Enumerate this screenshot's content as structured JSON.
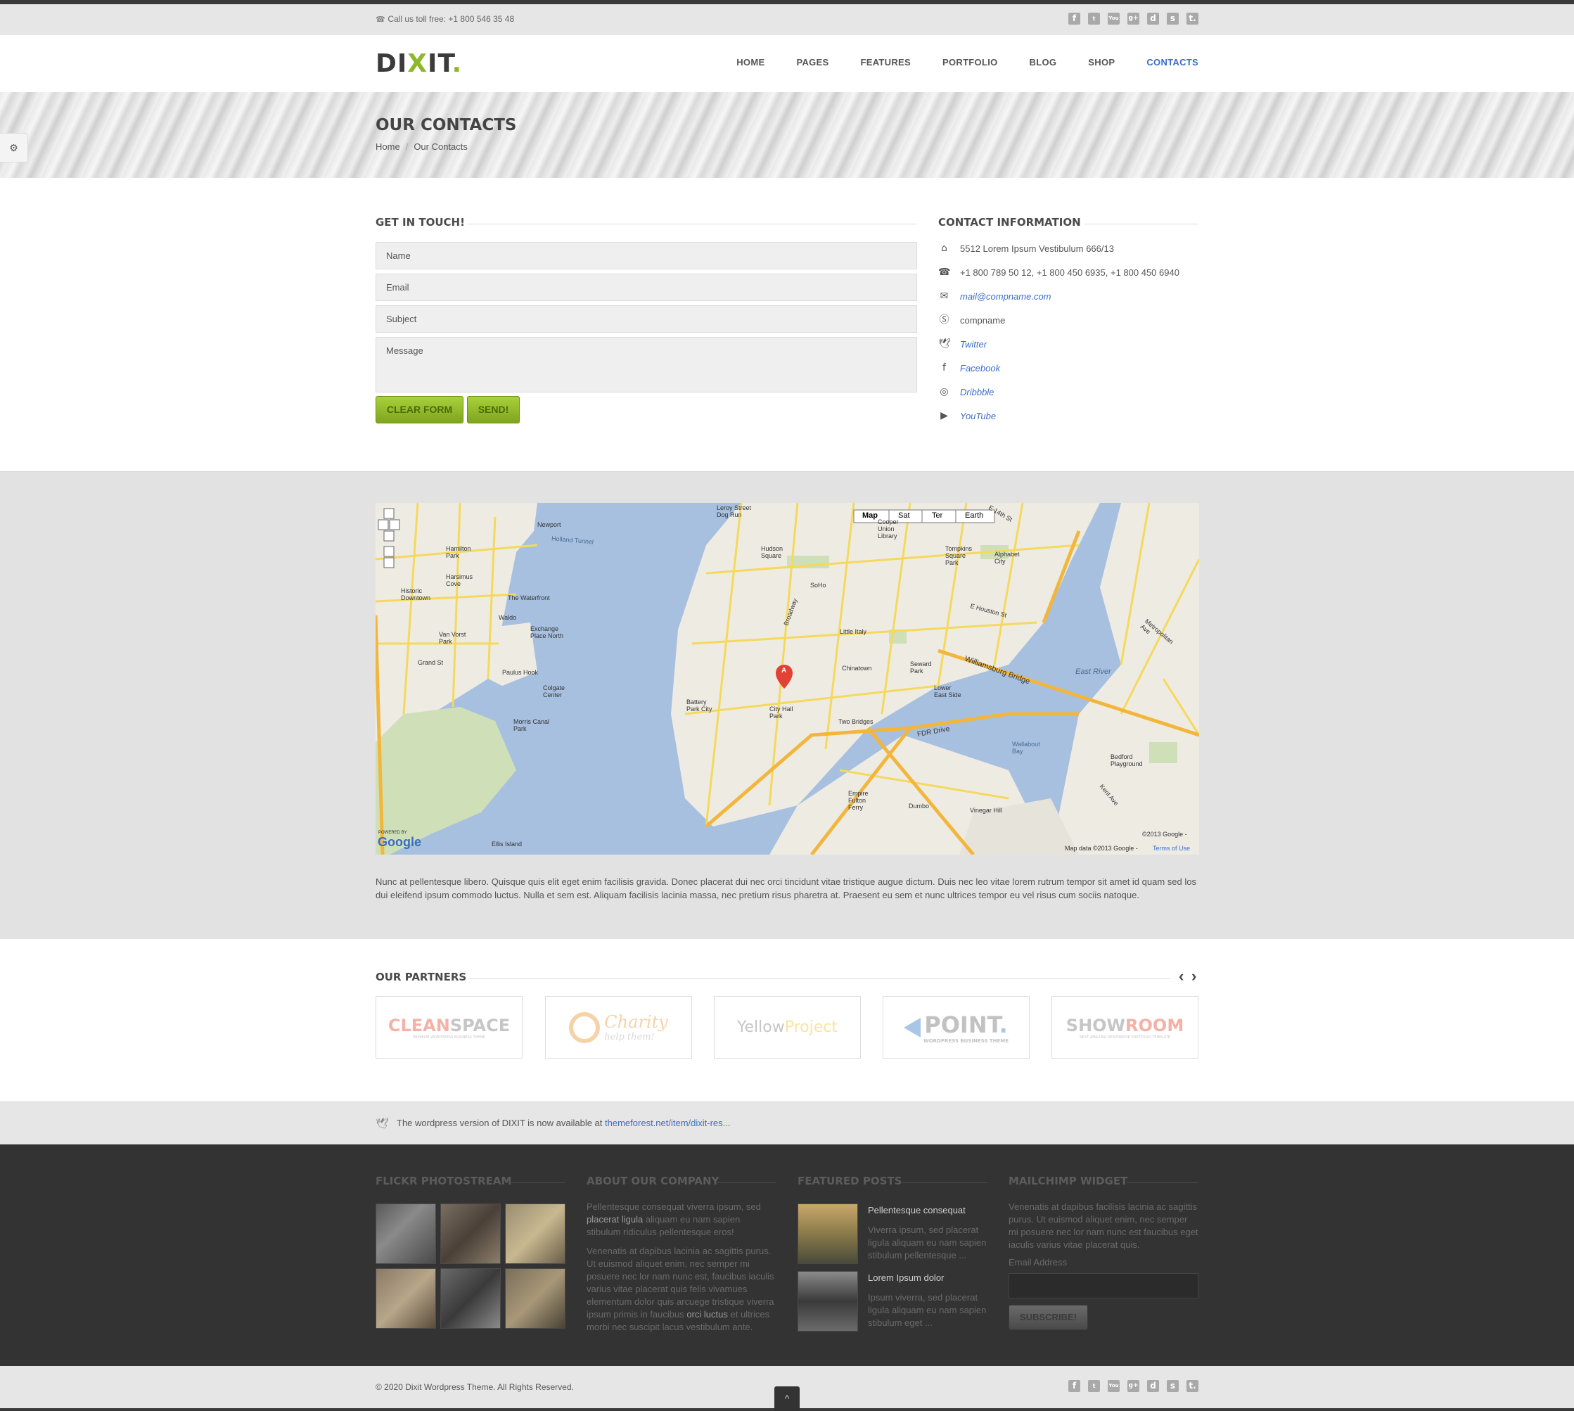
{
  "topbar": {
    "phone_label": "Call us toll free:",
    "phone_number": "+1 800 546 35 48"
  },
  "socials": [
    "f",
    "t",
    "You",
    "g+",
    "d",
    "s",
    "t."
  ],
  "header": {
    "logo_text": "DI",
    "logo_x": "X",
    "logo_rest": "IT",
    "logo_dot": ".",
    "nav": [
      "HOME",
      "PAGES",
      "FEATURES",
      "PORTFOLIO",
      "BLOG",
      "SHOP",
      "CONTACTS"
    ]
  },
  "page": {
    "title": "OUR CONTACTS",
    "breadcrumb_home": "Home",
    "breadcrumb_sep": "/",
    "breadcrumb_current": "Our Contacts"
  },
  "form": {
    "title": "GET IN TOUCH!",
    "name_placeholder": "Name",
    "email_placeholder": "Email",
    "subject_placeholder": "Subject",
    "message_placeholder": "Message",
    "clear_label": "CLEAR FORM",
    "send_label": "SEND!"
  },
  "contact_info": {
    "title": "CONTACT INFORMATION",
    "address": "5512 Lorem Ipsum Vestibulum 666/13",
    "phones": "+1 800 789 50 12, +1 800 450 6935, +1 800 450 6940",
    "email": "mail@compname.com",
    "skype": "compname",
    "twitter": "Twitter",
    "facebook": "Facebook",
    "dribbble": "Dribbble",
    "youtube": "YouTube"
  },
  "map": {
    "tabs": [
      "Map",
      "Sat",
      "Ter",
      "Earth"
    ],
    "labels": [
      "Newport",
      "Hamilton Park",
      "Harsimus Cove",
      "Historic Downtown",
      "The Waterfront",
      "Van Vorst Park",
      "Waldo",
      "Exchange Place North",
      "Paulus Hook",
      "Colgate Center",
      "Morris Canal Park",
      "Ellis Island",
      "Leroy Street Dog Run",
      "Hudson Square",
      "SoHo",
      "Little Italy",
      "Chinatown",
      "Battery Park City",
      "City Hall Park",
      "Two Bridges",
      "Lower East Side",
      "Seward Park",
      "Tompkins Square Park",
      "Alphabet City",
      "Cooper Union Library",
      "East River",
      "Wallabout Bay",
      "Bedford Playground",
      "Dumbo",
      "Vinegar Hill",
      "Empire Fulton Ferry",
      "Williamsburg Bridge",
      "FDR Drive",
      "Holland Tunnel",
      "Grand St",
      "Broadway",
      "E Houston St",
      "E 14th St",
      "Metropolitan Ave",
      "Kent Ave"
    ],
    "powered_by": "POWERED BY",
    "google": "Google",
    "copyright": "©2013 Google -",
    "map_data": "Map data ©2013 Google -",
    "terms": "Terms of Use",
    "marker": "A"
  },
  "map_description": "Nunc at pellentesque libero. Quisque quis elit eget enim facilisis gravida. Donec placerat dui nec orci tincidunt vitae tristique augue dictum. Duis nec leo vitae lorem rutrum tempor sit amet id quam sed los dui eleifend ipsum commodo luctus. Nulla et sem est. Aliquam facilisis lacinia massa, nec pretium risus pharetra at. Praesent eu sem et nunc ultrices tempor eu vel risus cum sociis natoque.",
  "partners": {
    "title": "OUR PARTNERS",
    "prev": "‹",
    "next": "›",
    "items": [
      {
        "a": "CLEAN",
        "b": "SPACE",
        "sub": "PREMIUM WORDPRESS BUSINESS THEME"
      },
      {
        "a": "Charity",
        "b": "help them!",
        "sub": ""
      },
      {
        "a": "Yellow",
        "b": "Project",
        "sub": ""
      },
      {
        "a": "POINT",
        "b": ".",
        "sub": "WORDPRESS BUSINESS THEME"
      },
      {
        "a": "SHOW",
        "b": "ROOM",
        "sub": "NEXT AMAZING RESPONSIVE PORTFOLIO TEMPLATE"
      }
    ]
  },
  "tweet": {
    "text": "The wordpress version of DIXIT is now available at",
    "link": "themeforest.net/item/dixit-res..."
  },
  "footer": {
    "flickr_title": "FLICKR PHOTOSTREAM",
    "about_title": "ABOUT OUR COMPANY",
    "about_p1_a": "Pellentesque consequat viverra ipsum, sed",
    "about_p1_b": "placerat ligula",
    "about_p1_c": "aliquam eu nam sapien stibulum ridiculus pellentesque eros!",
    "about_p2_a": "Venenatis at dapibus lacinia ac sagittis purus. Ut euismod aliquet enim, nec semper mi posuere nec lor nam nunc est, faucibus iaculis varius vitae placerat quis felis vivamues elementum dolor quis arcuege tristique viverra ipsum primis in faucibus",
    "about_p2_b": "orci luctus",
    "about_p2_c": "et ultrices morbi nec suscipit lacus vestibulum ante.",
    "posts_title": "FEATURED POSTS",
    "posts": [
      {
        "title": "Pellentesque consequat",
        "text": "Viverra ipsum, sed placerat ligula aliquam eu nam sapien stibulum pellentesque ..."
      },
      {
        "title": "Lorem Ipsum dolor",
        "text": "Ipsum viverra, sed placerat ligula aliquam eu nam sapien stibulum eget ..."
      }
    ],
    "mailchimp_title": "MAILCHIMP WIDGET",
    "mailchimp_text": "Venenatis at dapibus facilisis lacinia ac sagittis purus. Ut euismod aliquet enim, nec semper mi posuere nec lor nam nunc est faucibus eget iaculis varius vitae placerat quis.",
    "email_label": "Email Address",
    "subscribe_label": "SUBSCRIBE!"
  },
  "bottom": {
    "copyright": "© 2020 Dixit Wordpress Theme. All Rights Reserved.",
    "to_top": "^"
  },
  "colors": {
    "accent_green": "#8cb82a",
    "link_blue": "#3a6ec9",
    "footer_bg": "#333333"
  }
}
